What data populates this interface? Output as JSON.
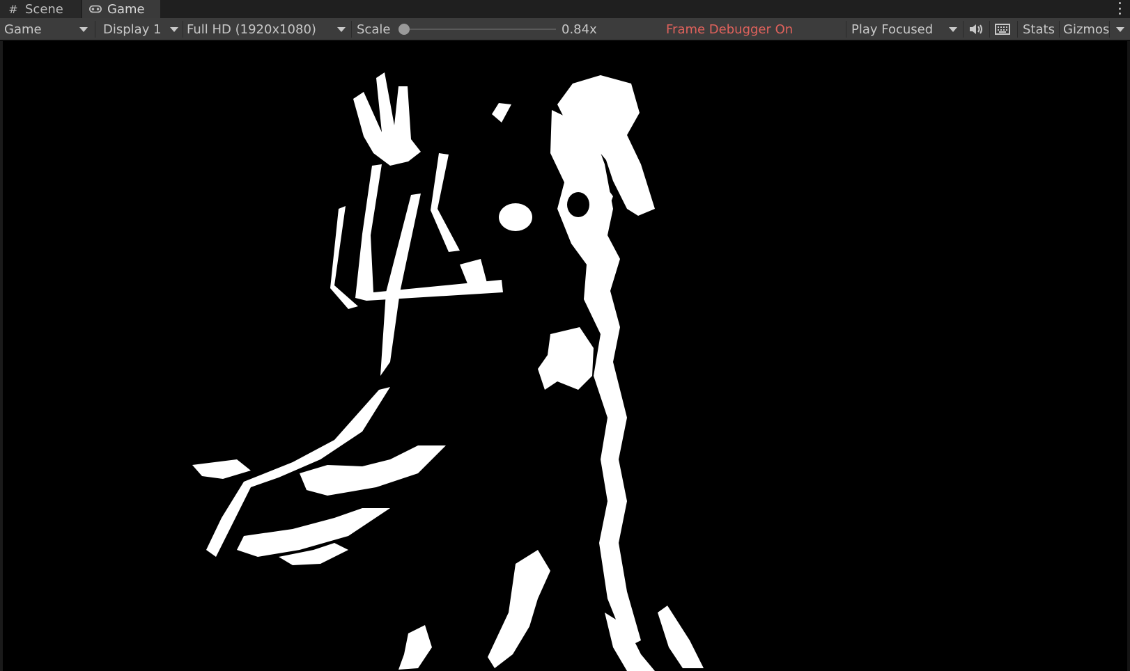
{
  "tabs": [
    {
      "label": "Scene",
      "icon": "hash-grid-icon",
      "active": false
    },
    {
      "label": "Game",
      "icon": "gamepad-icon",
      "active": true
    }
  ],
  "toolbar": {
    "view_mode": "Game",
    "display": "Display 1",
    "resolution": "Full HD (1920x1080)",
    "scale_label": "Scale",
    "scale_value": "0.84x",
    "frame_debugger": "Frame Debugger On",
    "play_mode": "Play Focused",
    "stats": "Stats",
    "gizmos": "Gizmos"
  },
  "colors": {
    "frame_debugger_text": "#e0625c",
    "toolbar_bg": "#3c3c3c",
    "viewport_bg": "#000000",
    "silhouette_fill": "#ffffff"
  }
}
